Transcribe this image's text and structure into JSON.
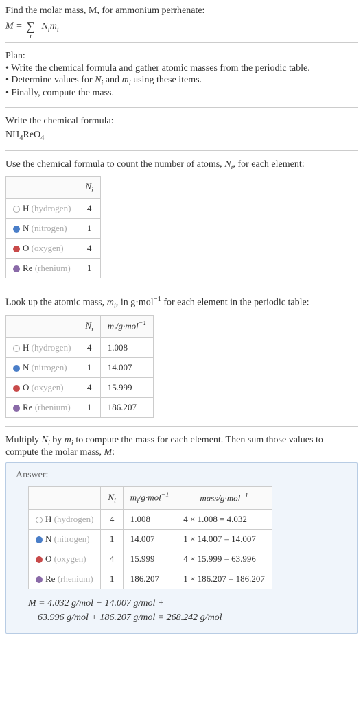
{
  "intro": {
    "line1": "Find the molar mass, M, for ammonium perrhenate:",
    "formula_left": "M = ",
    "sigma": "∑",
    "sigma_sub": "i",
    "formula_right_n": "N",
    "formula_right_ni": "i",
    "formula_right_m": "m",
    "formula_right_mi": "i"
  },
  "plan": {
    "header": "Plan:",
    "items": [
      "• Write the chemical formula and gather atomic masses from the periodic table.",
      "• Determine values for Nᵢ and mᵢ using these items.",
      "• Finally, compute the mass."
    ]
  },
  "chem": {
    "label": "Write the chemical formula:",
    "formula_parts": [
      "NH",
      "4",
      "ReO",
      "4"
    ]
  },
  "count": {
    "intro_a": "Use the chemical formula to count the number of atoms, ",
    "intro_n": "N",
    "intro_ni": "i",
    "intro_b": ", for each element:",
    "header_ni": "Nᵢ",
    "rows": [
      {
        "dot": "dot-h",
        "sym": "H",
        "name": "(hydrogen)",
        "n": "4"
      },
      {
        "dot": "dot-n",
        "sym": "N",
        "name": "(nitrogen)",
        "n": "1"
      },
      {
        "dot": "dot-o",
        "sym": "O",
        "name": "(oxygen)",
        "n": "4"
      },
      {
        "dot": "dot-re",
        "sym": "Re",
        "name": "(rhenium)",
        "n": "1"
      }
    ]
  },
  "lookup": {
    "intro_a": "Look up the atomic mass, ",
    "intro_m": "m",
    "intro_mi": "i",
    "intro_b": ", in g·mol",
    "intro_exp": "−1",
    "intro_c": " for each element in the periodic table:",
    "header_ni": "Nᵢ",
    "header_mi_a": "m",
    "header_mi_i": "i",
    "header_mi_b": "/g·mol",
    "header_mi_exp": "−1",
    "rows": [
      {
        "dot": "dot-h",
        "sym": "H",
        "name": "(hydrogen)",
        "n": "4",
        "m": "1.008"
      },
      {
        "dot": "dot-n",
        "sym": "N",
        "name": "(nitrogen)",
        "n": "1",
        "m": "14.007"
      },
      {
        "dot": "dot-o",
        "sym": "O",
        "name": "(oxygen)",
        "n": "4",
        "m": "15.999"
      },
      {
        "dot": "dot-re",
        "sym": "Re",
        "name": "(rhenium)",
        "n": "1",
        "m": "186.207"
      }
    ]
  },
  "multiply": {
    "text_a": "Multiply ",
    "n": "N",
    "ni": "i",
    "text_b": " by ",
    "m": "m",
    "mi": "i",
    "text_c": " to compute the mass for each element. Then sum those values to compute the molar mass, ",
    "M": "M",
    "text_d": ":"
  },
  "answer": {
    "label": "Answer:",
    "header_ni": "Nᵢ",
    "header_mi_a": "m",
    "header_mi_i": "i",
    "header_mi_b": "/g·mol",
    "header_mi_exp": "−1",
    "header_mass_a": "mass/g·mol",
    "header_mass_exp": "−1",
    "rows": [
      {
        "dot": "dot-h",
        "sym": "H",
        "name": "(hydrogen)",
        "n": "4",
        "m": "1.008",
        "mass": "4 × 1.008 = 4.032"
      },
      {
        "dot": "dot-n",
        "sym": "N",
        "name": "(nitrogen)",
        "n": "1",
        "m": "14.007",
        "mass": "1 × 14.007 = 14.007"
      },
      {
        "dot": "dot-o",
        "sym": "O",
        "name": "(oxygen)",
        "n": "4",
        "m": "15.999",
        "mass": "4 × 15.999 = 63.996"
      },
      {
        "dot": "dot-re",
        "sym": "Re",
        "name": "(rhenium)",
        "n": "1",
        "m": "186.207",
        "mass": "1 × 186.207 = 186.207"
      }
    ],
    "final_a": "M = 4.032 g/mol + 14.007 g/mol +",
    "final_b": "63.996 g/mol + 186.207 g/mol = 268.242 g/mol"
  }
}
